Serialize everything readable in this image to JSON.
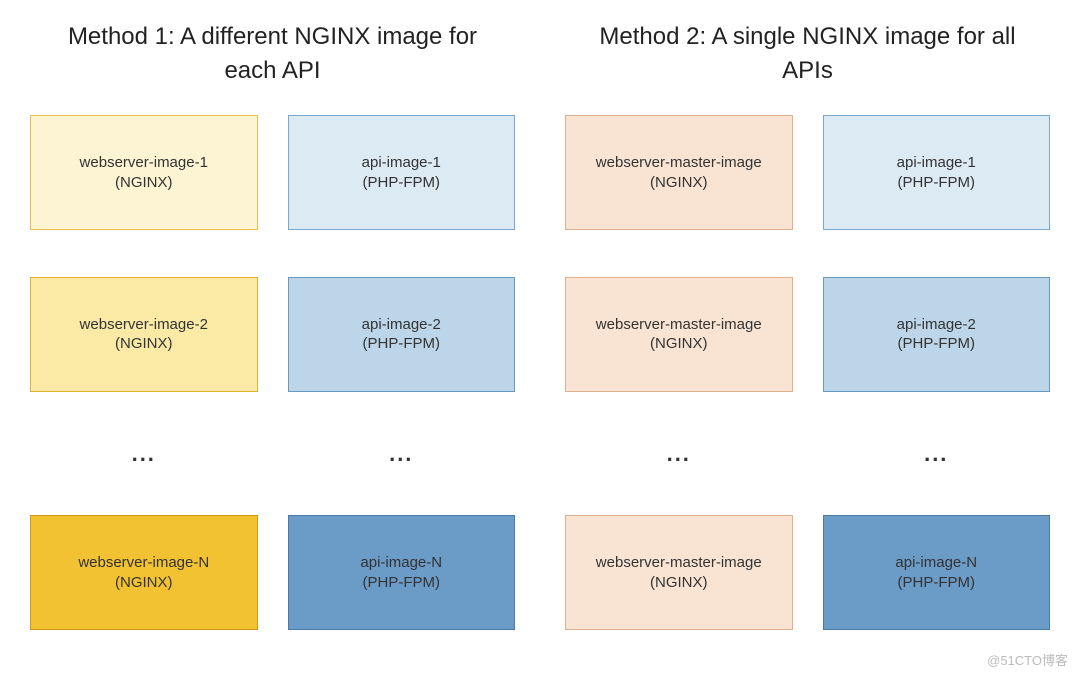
{
  "method1": {
    "title": "Method 1: A different NGINX image for each API",
    "rows": [
      {
        "left": {
          "line1": "webserver-image-1",
          "line2": "(NGINX)",
          "class": "yellow-light"
        },
        "right": {
          "line1": "api-image-1",
          "line2": "(PHP-FPM)",
          "class": "blue-light"
        }
      },
      {
        "left": {
          "line1": "webserver-image-2",
          "line2": "(NGINX)",
          "class": "yellow-med"
        },
        "right": {
          "line1": "api-image-2",
          "line2": "(PHP-FPM)",
          "class": "blue-med"
        }
      },
      {
        "left": {
          "line1": "webserver-image-N",
          "line2": "(NGINX)",
          "class": "yellow-dark"
        },
        "right": {
          "line1": "api-image-N",
          "line2": "(PHP-FPM)",
          "class": "blue-dark"
        }
      }
    ]
  },
  "method2": {
    "title": "Method 2: A single NGINX image for all APIs",
    "rows": [
      {
        "left": {
          "line1": "webserver-master-image",
          "line2": "(NGINX)",
          "class": "peach"
        },
        "right": {
          "line1": "api-image-1",
          "line2": "(PHP-FPM)",
          "class": "blue-light"
        }
      },
      {
        "left": {
          "line1": "webserver-master-image",
          "line2": "(NGINX)",
          "class": "peach"
        },
        "right": {
          "line1": "api-image-2",
          "line2": "(PHP-FPM)",
          "class": "blue-med"
        }
      },
      {
        "left": {
          "line1": "webserver-master-image",
          "line2": "(NGINX)",
          "class": "peach"
        },
        "right": {
          "line1": "api-image-N",
          "line2": "(PHP-FPM)",
          "class": "blue-dark"
        }
      }
    ]
  },
  "ellipsis": "...",
  "watermark": "@51CTO博客"
}
